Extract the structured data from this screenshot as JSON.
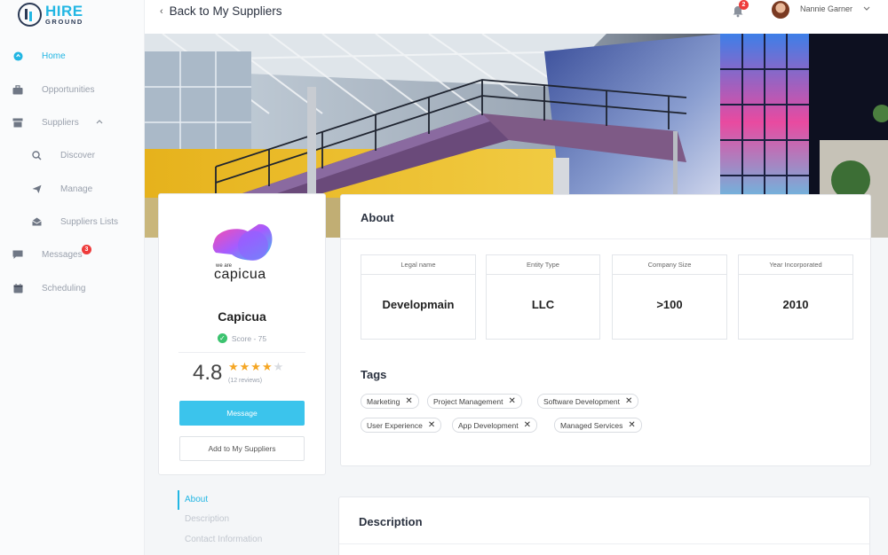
{
  "brand": {
    "line1": "HIRE",
    "line2": "GROUND"
  },
  "sidebar": {
    "items": [
      {
        "label": "Home",
        "icon": "home-icon"
      },
      {
        "label": "Opportunities",
        "icon": "briefcase-icon"
      },
      {
        "label": "Suppliers",
        "icon": "suppliers-icon"
      },
      {
        "label": "Discover",
        "icon": "search-icon"
      },
      {
        "label": "Manage",
        "icon": "send-icon"
      },
      {
        "label": "Suppliers Lists",
        "icon": "inbox-icon"
      },
      {
        "label": "Messages",
        "icon": "chat-icon",
        "badge": "3"
      },
      {
        "label": "Scheduling",
        "icon": "calendar-icon"
      }
    ]
  },
  "header": {
    "back_label": "Back to My Suppliers",
    "notification_count": "2",
    "user_name": "Nannie Garner"
  },
  "profile": {
    "logo_small": "we are",
    "logo_word": "capicua",
    "company_name": "Capicua",
    "score": "Score - 75",
    "rating": "4.8",
    "stars_filled": "★★★★",
    "stars_empty": "★",
    "reviews": "(12 reviews)",
    "message_label": "Message",
    "add_label": "Add to My Suppliers"
  },
  "about": {
    "title": "About",
    "info": [
      {
        "label": "Legal name",
        "value": "Developmain"
      },
      {
        "label": "Entity Type",
        "value": "LLC"
      },
      {
        "label": "Company Size",
        "value": ">100"
      },
      {
        "label": "Year Incorporated",
        "value": "2010"
      }
    ],
    "tags_title": "Tags",
    "tags": [
      "Marketing",
      "Project Management",
      "Software Development",
      "User Experience",
      "App Development",
      "Managed Services"
    ]
  },
  "section_nav": [
    "About",
    "Description",
    "Contact Information"
  ],
  "description": {
    "title": "Description"
  },
  "colors": {
    "accent": "#22b6e3",
    "badge": "#ee3b3b",
    "star": "#f5a623"
  }
}
